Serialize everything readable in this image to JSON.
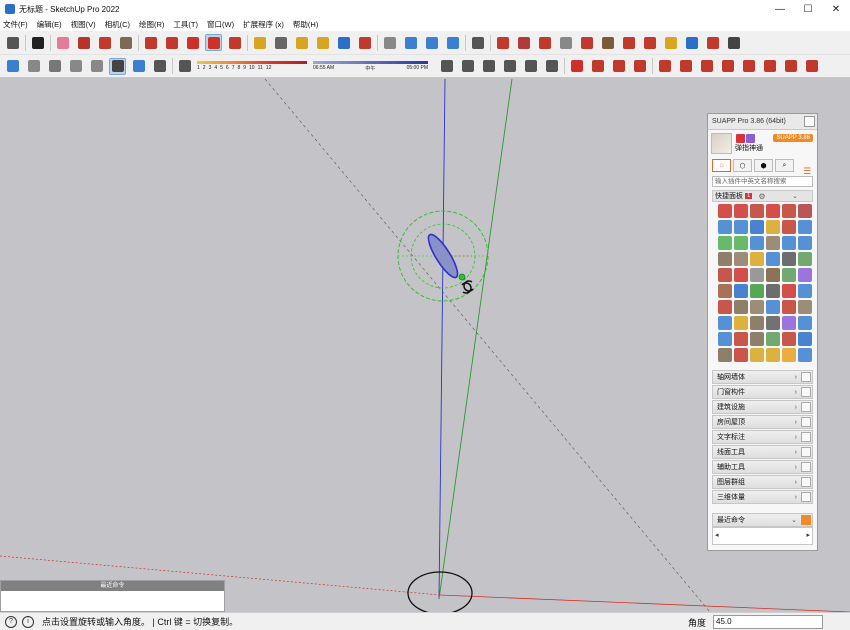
{
  "window": {
    "title": "无标题 - SketchUp Pro 2022",
    "controls": [
      "—",
      "☐",
      "✕"
    ]
  },
  "menu": [
    "文件(F)",
    "编辑(E)",
    "视图(V)",
    "相机(C)",
    "绘图(R)",
    "工具(T)",
    "窗口(W)",
    "扩展程序 (x)",
    "帮助(H)"
  ],
  "toolbar": {
    "row1": [
      {
        "name": "zoom-icon",
        "color": "#555555"
      },
      {
        "name": "select-icon",
        "color": "#222222"
      },
      {
        "name": "eraser-icon",
        "color": "#e57a9b"
      },
      {
        "name": "pencil-icon",
        "color": "#b8332a"
      },
      {
        "name": "arc-icon",
        "color": "#c0392b"
      },
      {
        "name": "paint-bucket-icon",
        "color": "#7d6a54"
      },
      {
        "name": "push-pull-icon",
        "color": "#c0392b"
      },
      {
        "name": "follow-me-icon",
        "color": "#c0392b"
      },
      {
        "name": "move-icon",
        "color": "#d0302a"
      },
      {
        "name": "rotate-icon",
        "color": "#d0302a",
        "active": true
      },
      {
        "name": "scale-icon",
        "color": "#c0392b"
      },
      {
        "name": "tape-measure-icon",
        "color": "#d8a520"
      },
      {
        "name": "text-icon",
        "color": "#666666"
      },
      {
        "name": "axes-icon",
        "color": "#d8a520"
      },
      {
        "name": "orbit-icon",
        "color": "#d8a520"
      },
      {
        "name": "pan-icon",
        "color": "#2a6fc8"
      },
      {
        "name": "zoom-extents-icon",
        "color": "#c0392b"
      },
      {
        "name": "sandbox-icon",
        "color": "#888888"
      },
      {
        "name": "smoove-icon",
        "color": "#3a7fd0"
      },
      {
        "name": "stamp-icon",
        "color": "#3a7fd0"
      },
      {
        "name": "drape-icon",
        "color": "#3a7fd0"
      },
      {
        "name": "user-icon",
        "color": "#555555"
      },
      {
        "name": "warehouse-icon",
        "color": "#c0392b"
      },
      {
        "name": "extension-icon",
        "color": "#b23a3a"
      },
      {
        "name": "layout-icon",
        "color": "#c0392b"
      },
      {
        "name": "style-builder-icon",
        "color": "#888888"
      },
      {
        "name": "component-icon",
        "color": "#c0392b"
      },
      {
        "name": "material-icon",
        "color": "#7a5a3a"
      },
      {
        "name": "section-icon",
        "color": "#c0392b"
      },
      {
        "name": "paint-icon",
        "color": "#c0392b"
      },
      {
        "name": "measure-icon",
        "color": "#d8a520"
      },
      {
        "name": "zoom-window-icon",
        "color": "#2a6fc8"
      },
      {
        "name": "position-camera-icon",
        "color": "#c0392b"
      },
      {
        "name": "walk-icon",
        "color": "#444444"
      }
    ],
    "row2": [
      {
        "name": "xray-icon",
        "color": "#3a7fd0"
      },
      {
        "name": "back-edges-icon",
        "color": "#888888"
      },
      {
        "name": "wireframe-icon",
        "color": "#777777"
      },
      {
        "name": "hidden-line-icon",
        "color": "#888888"
      },
      {
        "name": "shaded-icon",
        "color": "#888888"
      },
      {
        "name": "shaded-textures-icon",
        "color": "#444444",
        "active": true
      },
      {
        "name": "monochrome-icon",
        "color": "#3a7fd0"
      },
      {
        "name": "shadows-toggle-icon",
        "color": "#555555"
      }
    ],
    "shadow_scale": [
      "1",
      "2",
      "3",
      "4",
      "5",
      "6",
      "7",
      "8",
      "9",
      "10",
      "11",
      "12"
    ],
    "time": {
      "start": "06:55 AM",
      "mid": "中午",
      "end": "05:00 PM"
    },
    "row2b": [
      {
        "name": "iso-view-icon",
        "color": "#555555"
      },
      {
        "name": "top-view-icon",
        "color": "#555555"
      },
      {
        "name": "front-view-icon",
        "color": "#555555"
      },
      {
        "name": "right-view-icon",
        "color": "#555555"
      },
      {
        "name": "back-view-icon",
        "color": "#555555"
      },
      {
        "name": "left-view-icon",
        "color": "#555555"
      },
      {
        "name": "suapp-logo-icon",
        "color": "#d0302a"
      },
      {
        "name": "cube-icon",
        "color": "#c0392b"
      },
      {
        "name": "atom-icon",
        "color": "#c0392b"
      },
      {
        "name": "gear-icon",
        "color": "#c0392b"
      },
      {
        "name": "chain-icon",
        "color": "#c0392b"
      },
      {
        "name": "magnet-icon",
        "color": "#c0392b"
      },
      {
        "name": "plugin-a-icon",
        "color": "#c0392b"
      },
      {
        "name": "plugin-b-icon",
        "color": "#c0392b"
      },
      {
        "name": "plugin-c-icon",
        "color": "#c0392b"
      },
      {
        "name": "plugin-d-icon",
        "color": "#c0392b"
      },
      {
        "name": "plugin-e-icon",
        "color": "#c0392b"
      },
      {
        "name": "plugin-f-icon",
        "color": "#c0392b"
      }
    ]
  },
  "suapp": {
    "title": "SUAPP Pro 3.86 (64bit)",
    "user": "弹指神通",
    "version": "SUAPP 3.86",
    "tabs": [
      "⌂",
      "⬡",
      "⬢",
      "⌕"
    ],
    "search_placeholder": "输入插件中英文名称搜索",
    "quick_panel": "快捷面板",
    "quick_count": "1",
    "grid_colors": [
      "#d0302a",
      "#d0302a",
      "#c0392b",
      "#d0302a",
      "#c0392b",
      "#b23a3a",
      "#3a7fd0",
      "#3a7fd0",
      "#2a6fc8",
      "#d8a520",
      "#c0392b",
      "#3a7fd0",
      "#4caf50",
      "#4caf50",
      "#3a7fd0",
      "#8b7a60",
      "#3a7fd0",
      "#3a7fd0",
      "#7a6a50",
      "#8b7a60",
      "#d8a520",
      "#3a7fd0",
      "#555555",
      "#5a9a5a",
      "#c0392b",
      "#d0302a",
      "#888888",
      "#7a5a3a",
      "#5a9a5a",
      "#8b5ed8",
      "#9a5a3a",
      "#2a6fc8",
      "#3a9a3a",
      "#555555",
      "#d0302a",
      "#3a7fd0",
      "#c0392b",
      "#7a6a50",
      "#8b7a60",
      "#3a7fd0",
      "#c0392b",
      "#8b7a60",
      "#3a7fd0",
      "#d8a520",
      "#7a6a50",
      "#5a5a5a",
      "#8b5ed8",
      "#3a7fd0",
      "#3a7fd0",
      "#c0392b",
      "#7a6a50",
      "#5a9a5a",
      "#c0392b",
      "#2a6fc8",
      "#7a6a50",
      "#c0392b",
      "#d8a520",
      "#d8a520",
      "#e6a020",
      "#3a7fd0"
    ],
    "categories": [
      "轴网墙体",
      "门窗构件",
      "建筑设施",
      "房间屋顶",
      "文字标注",
      "线面工具",
      "辅助工具",
      "图层群组",
      "三维体量"
    ],
    "recent_label": "最近命令",
    "scroll_left": "◂",
    "scroll_right": "▸"
  },
  "recent_mini_title": "最近命令",
  "status": {
    "message": "点击设置旋转或输入角度。 | Ctrl 键 = 切换复制。",
    "vcb_label": "角度",
    "vcb_value": "45.0"
  }
}
